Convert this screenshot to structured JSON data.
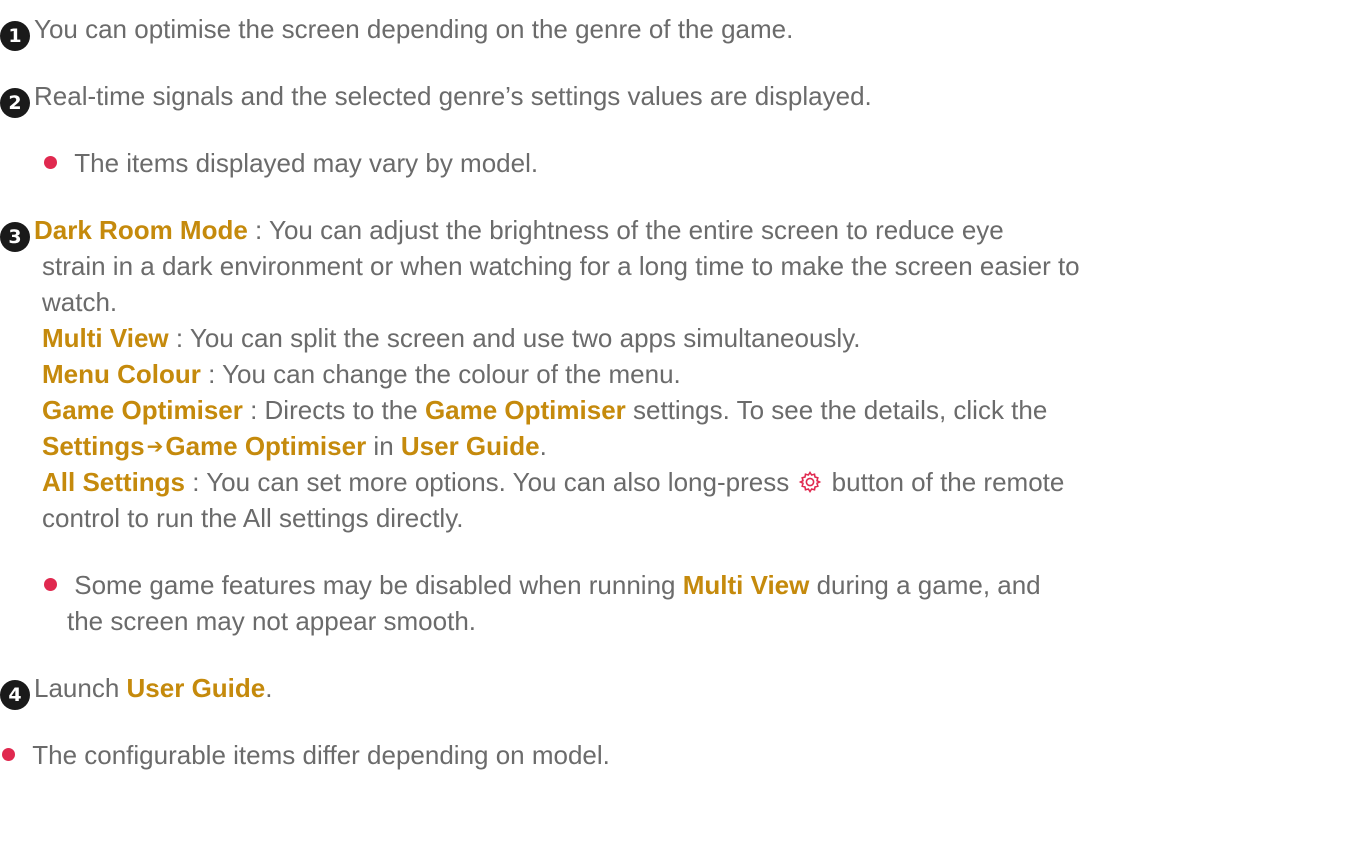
{
  "accent_color": "#c58a0c",
  "bullet_color": "#e0294f",
  "badge_color": "#1a1a1a",
  "items": [
    {
      "number": "1",
      "text": "You can optimise the screen depending on the genre of the game."
    },
    {
      "number": "2",
      "text": "Real-time signals and the selected genre’s settings values are displayed.",
      "note": "The items displayed may vary by model."
    },
    {
      "number": "3",
      "dark_room": {
        "label": "Dark Room Mode",
        "line1": " : You can adjust the brightness of the entire screen to reduce eye",
        "line2": "strain in a dark environment or when watching for a long time to make the screen easier to",
        "line3": "watch."
      },
      "multi_view": {
        "label": "Multi View",
        "text": " : You can split the screen and use two apps simultaneously."
      },
      "menu_colour": {
        "label": "Menu Colour",
        "text": " : You can change the colour of the menu."
      },
      "game_optimiser": {
        "label": "Game Optimiser",
        "text1": " : Directs to the ",
        "link": "Game Optimiser",
        "text2": " settings. To see the details, click the",
        "path_settings": "Settings",
        "path_game_optimiser": "Game Optimiser",
        "text3": " in ",
        "user_guide": "User Guide",
        "text4": "."
      },
      "all_settings": {
        "label": "All Settings",
        "text1": " : You can set more options. You can also long-press ",
        "icon": "settings-gear-icon",
        "text2": " button of the remote",
        "line2": "control to run the All settings directly."
      },
      "note": {
        "text1": "Some game features may be disabled when running ",
        "bold": "Multi View",
        "text2": " during a game, and",
        "line2": "the screen may not appear smooth."
      }
    },
    {
      "number": "4",
      "text": "Launch ",
      "bold": "User Guide",
      "end": "."
    }
  ],
  "footer_note": "The configurable items differ depending on model."
}
